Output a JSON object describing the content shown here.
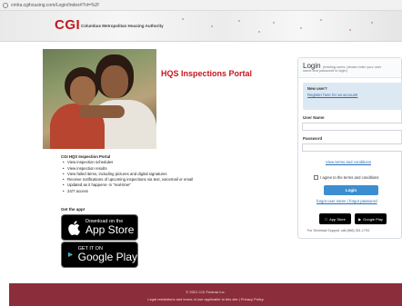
{
  "browser": {
    "url": "cmha.cgihousing.com/Login/Index#?nl=%2f",
    "lock_icon": "lock-icon"
  },
  "header": {
    "logo": "CGI",
    "org_name": "Columbus Metropolitan Housing Authority"
  },
  "portal": {
    "title": "HQS Inspections Portal",
    "features_title": "CGI HQS Inspection Portal",
    "features": [
      "View inspection schedules",
      "View inspection results",
      "View failed items, including pictures and digital signatures",
      "Receive notifications of upcoming inspections via text, voicemail or email",
      "Updated as it happens- in \"real-time\"",
      "24/7 access"
    ],
    "get_app": "Get the app!"
  },
  "stores": {
    "apple_small": "Download on the",
    "apple_big": "App Store",
    "google_small": "GET IT ON",
    "google_big": "Google Play"
  },
  "login": {
    "title": "Login",
    "subtitle_1": "(existing users: please enter your user",
    "subtitle_2": "name and password to login)",
    "new_user_title": "New user?",
    "register_link": "Register here for an account!",
    "username_label": "User Name",
    "username_value": "",
    "password_label": "Password",
    "password_value": "",
    "terms_link": "View terms and conditions",
    "agree_label": "I agree to the terms and conditions",
    "login_button": "Login",
    "forgot_user": "forgot user name",
    "separator": "|",
    "forgot_password": "forgot password",
    "mini_apple": "App Store",
    "mini_google": "Google Play",
    "support": "For Technical Support, call (866) 351-1793."
  },
  "footer": {
    "copyright": "© 2021 CGI Federal Inc.",
    "legal": "Legal restrictions and terms of use applicable to this site | Privacy Policy"
  },
  "colors": {
    "brand_red": "#c5161e",
    "link_blue": "#2a6fb5",
    "footer_bg": "#8b2d3a",
    "button_blue": "#3d8ed0"
  }
}
